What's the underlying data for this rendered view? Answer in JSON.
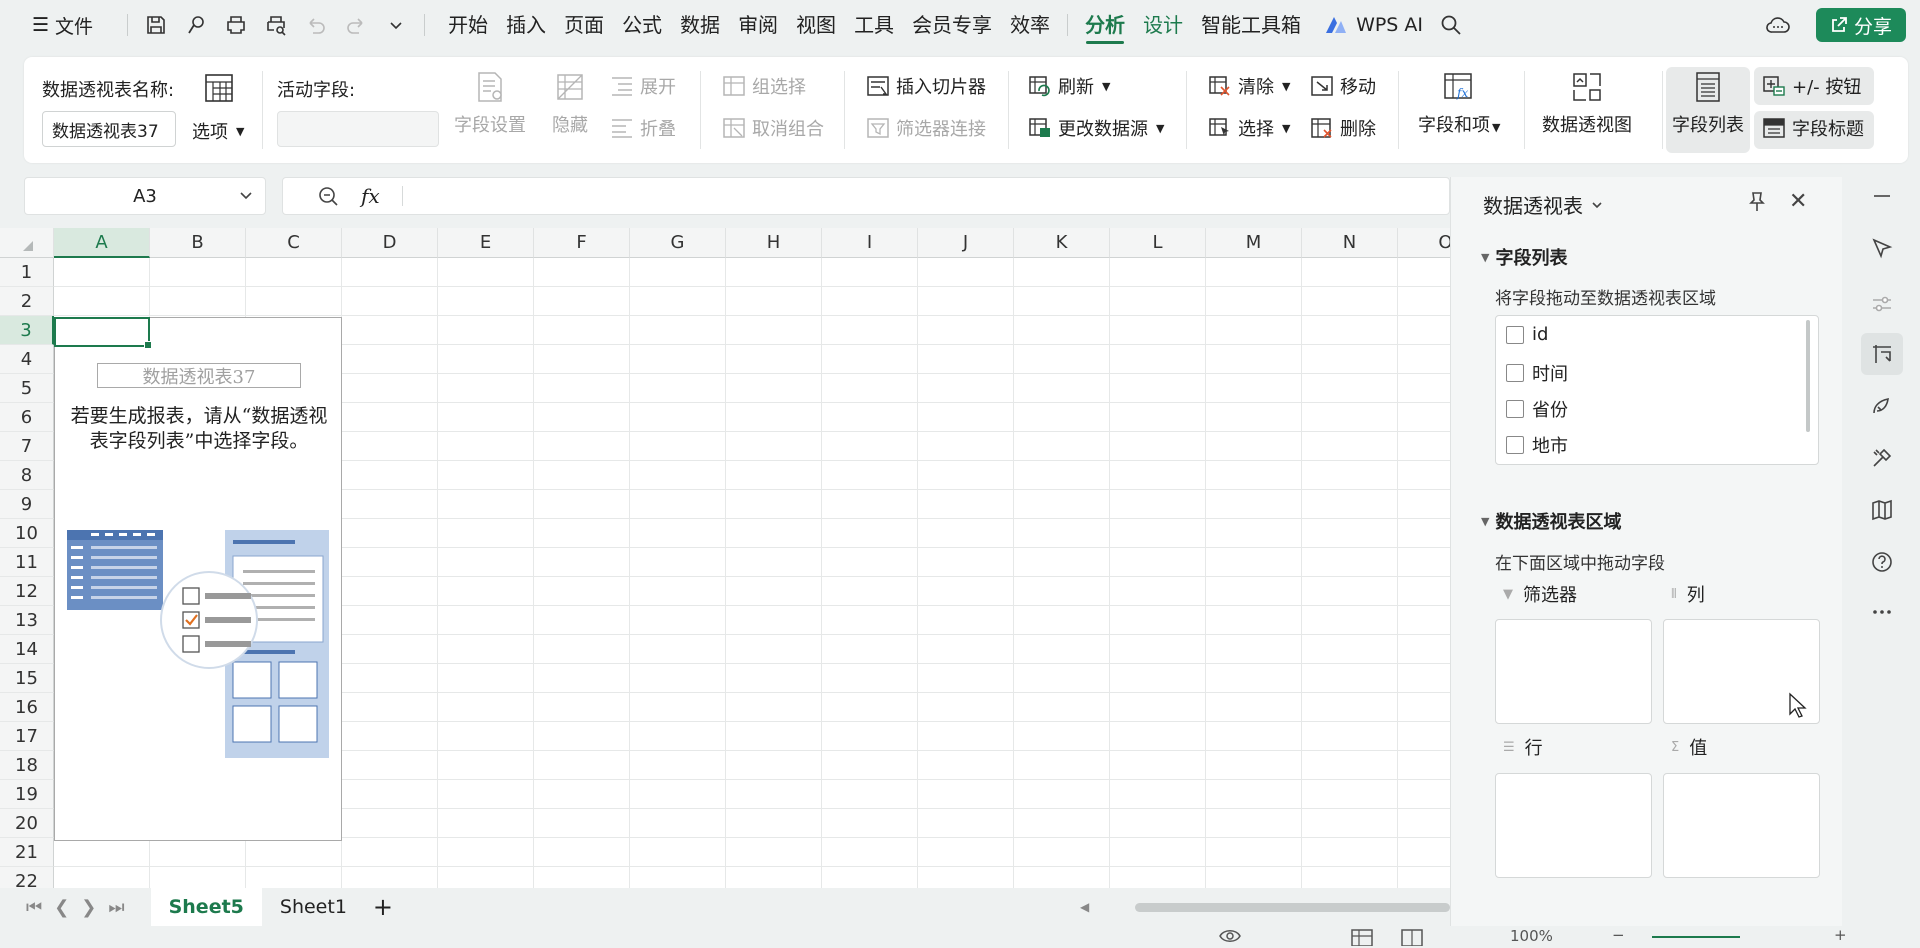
{
  "menubar": {
    "file_label": "文件",
    "tabs": [
      {
        "label": "开始"
      },
      {
        "label": "插入"
      },
      {
        "label": "页面"
      },
      {
        "label": "公式"
      },
      {
        "label": "数据"
      },
      {
        "label": "审阅"
      },
      {
        "label": "视图"
      },
      {
        "label": "工具"
      },
      {
        "label": "会员专享"
      },
      {
        "label": "效率"
      },
      {
        "label": "分析",
        "active": true
      },
      {
        "label": "设计"
      },
      {
        "label": "智能工具箱"
      }
    ],
    "wps_ai_label": "WPS AI",
    "share_label": "分享",
    "accent_color": "#1d7a4d"
  },
  "ribbon": {
    "pivot_name_label": "数据透视表名称:",
    "pivot_name_value": "数据透视表37",
    "options_label": "选项",
    "active_field_label": "活动字段:",
    "active_field_value": "",
    "field_settings_label": "字段设置",
    "hide_label": "隐藏",
    "expand_label": "展开",
    "collapse_label": "折叠",
    "group_select_label": "组选择",
    "ungroup_label": "取消组合",
    "insert_slicer_label": "插入切片器",
    "filter_connections_label": "筛选器连接",
    "refresh_label": "刷新",
    "change_source_label": "更改数据源",
    "clear_label": "清除",
    "move_label": "移动",
    "select_label": "选择",
    "delete_label": "删除",
    "fields_items_label": "字段和项",
    "pivot_chart_label": "数据透视图",
    "field_list_label": "字段列表",
    "buttons_label": "+/- 按钮",
    "field_headers_label": "字段标题"
  },
  "formula_bar": {
    "cell_ref": "A3",
    "fx_label": "fx",
    "formula": ""
  },
  "grid": {
    "columns": [
      "A",
      "B",
      "C",
      "D",
      "E",
      "F",
      "G",
      "H",
      "I",
      "J",
      "K",
      "L",
      "M",
      "N",
      "O"
    ],
    "rows": [
      "1",
      "2",
      "3",
      "4",
      "5",
      "6",
      "7",
      "8",
      "9",
      "10",
      "11",
      "12",
      "13",
      "14",
      "15",
      "16",
      "17",
      "18",
      "19",
      "20",
      "21",
      "22"
    ],
    "selected_col": "A",
    "selected_row": "3",
    "pivot_placeholder": {
      "name": "数据透视表37",
      "hint": "若要生成报表，请从“数据透视表字段列表”中选择字段。"
    }
  },
  "sheets": {
    "tabs": [
      {
        "label": "Sheet5",
        "active": true
      },
      {
        "label": "Sheet1"
      }
    ],
    "add_label": "+"
  },
  "status": {
    "zoom": "100%"
  },
  "panel": {
    "title": "数据透视表",
    "field_list_section": "字段列表",
    "field_list_hint": "将字段拖动至数据透视表区域",
    "fields": [
      {
        "label": "id"
      },
      {
        "label": "时间"
      },
      {
        "label": "省份"
      },
      {
        "label": "地市"
      }
    ],
    "areas_section": "数据透视表区域",
    "areas_hint": "在下面区域中拖动字段",
    "areas": {
      "filter": "筛选器",
      "columns": "列",
      "rows": "行",
      "values": "值"
    }
  }
}
